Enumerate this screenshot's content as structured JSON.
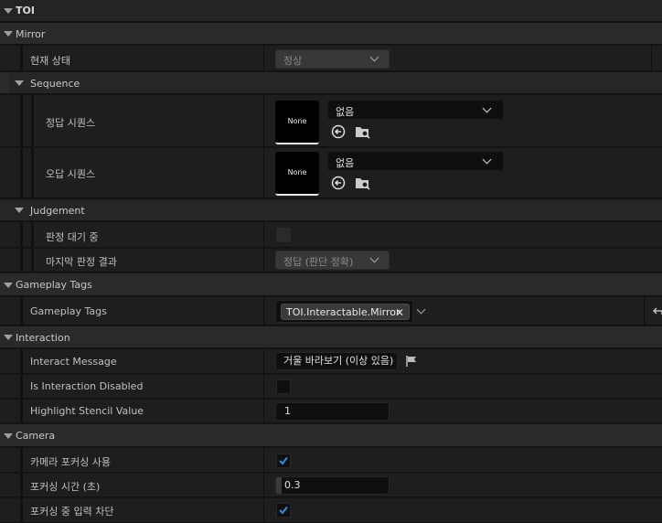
{
  "header": {
    "title": "TOI"
  },
  "mirror": {
    "title": "Mirror",
    "current_state": {
      "label": "현재 상태",
      "value": "정상"
    },
    "sequence": {
      "title": "Sequence",
      "correct": {
        "label": "정답 시퀀스",
        "thumb": "None",
        "value": "없음"
      },
      "wrong": {
        "label": "오답 시퀀스",
        "thumb": "None",
        "value": "없음"
      }
    },
    "judgement": {
      "title": "Judgement",
      "waiting": {
        "label": "판정 대기 중",
        "checked": false
      },
      "last_result": {
        "label": "마지막 판정 결과",
        "value": "정답 (판단 정확)"
      }
    }
  },
  "gameplay_tags": {
    "title": "Gameplay Tags",
    "row": {
      "label": "Gameplay Tags",
      "tag": "TOI.Interactable.Mirror",
      "remove": "✕"
    }
  },
  "interaction": {
    "title": "Interaction",
    "message": {
      "label": "Interact Message",
      "value": "거울 바라보기 (이상 있음)"
    },
    "disabled": {
      "label": "Is Interaction Disabled",
      "checked": false
    },
    "stencil": {
      "label": "Highlight Stencil Value",
      "value": "1"
    }
  },
  "camera": {
    "title": "Camera",
    "focus_use": {
      "label": "카메라 포커싱 사용",
      "checked": true
    },
    "focus_time": {
      "label": "포커싱 시간 (초)",
      "value": "0.3"
    },
    "block_input": {
      "label": "포커싱 중 입력 차단",
      "checked": true
    }
  },
  "colors": {
    "accent_check": "#2f8fe0"
  }
}
